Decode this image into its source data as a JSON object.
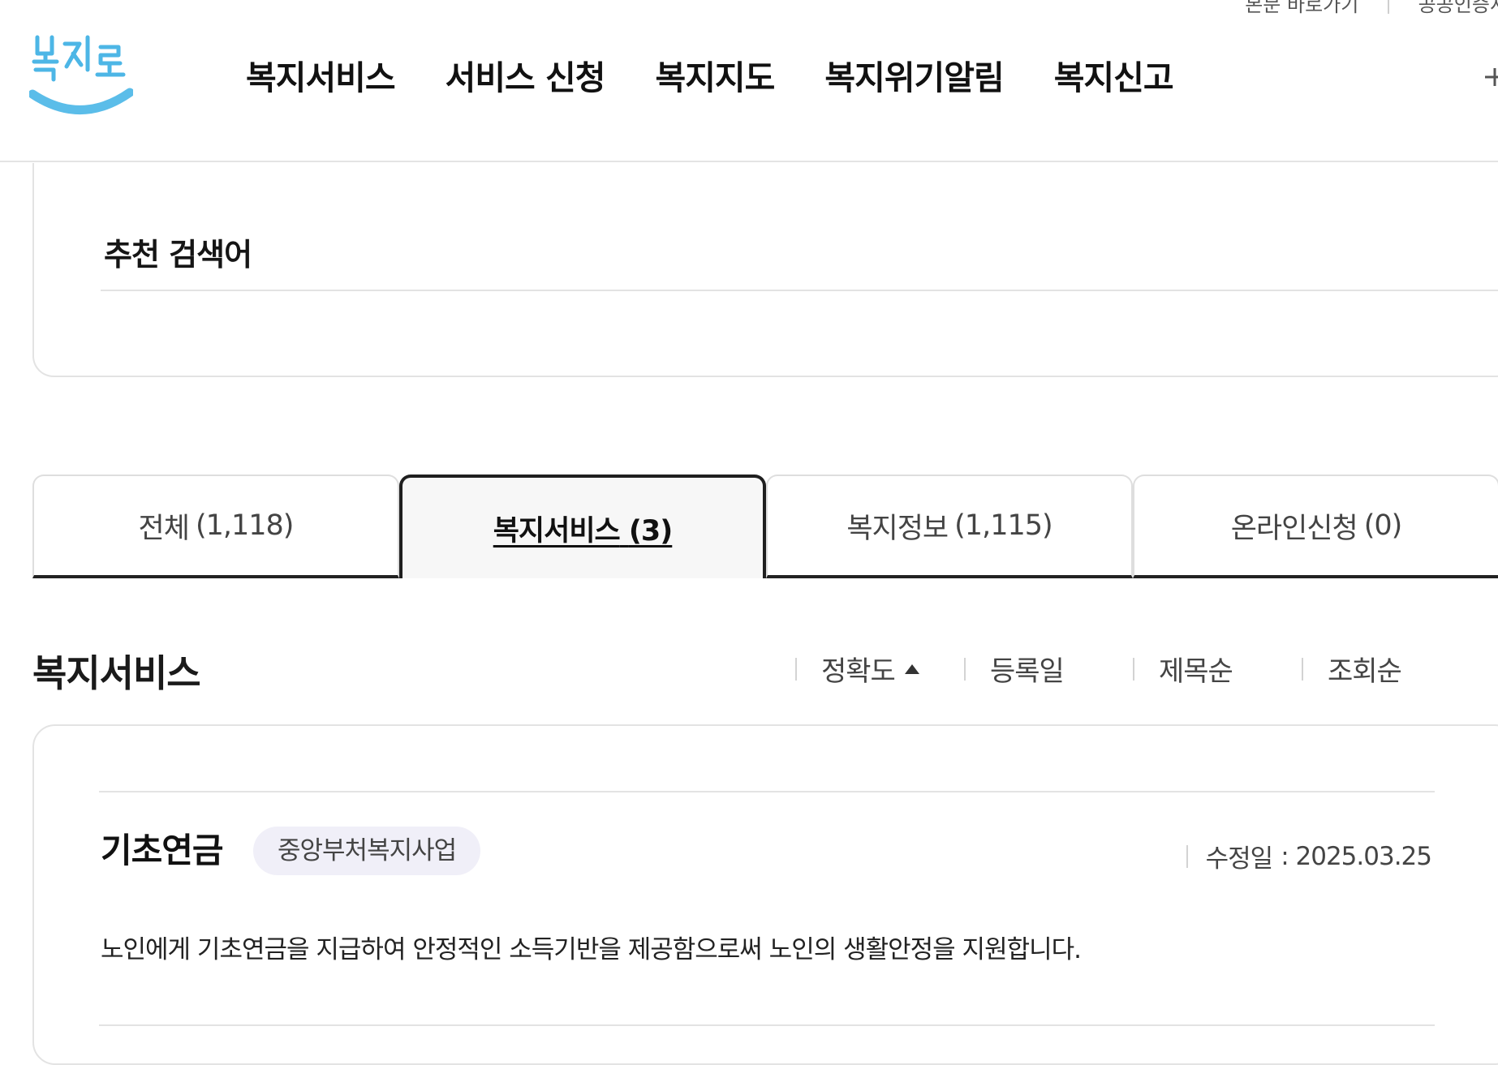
{
  "header": {
    "logo_text": "복지로",
    "utility_links": [
      "본문 바로가기",
      "공공인증서"
    ],
    "nav": [
      "복지서비스",
      "서비스 신청",
      "복지지도",
      "복지위기알림",
      "복지신고"
    ]
  },
  "recommend": {
    "title": "추천 검색어"
  },
  "tabs": [
    {
      "label": "전체",
      "count": "(1,118)",
      "active": false
    },
    {
      "label": "복지서비스",
      "count": "(3)",
      "active": true
    },
    {
      "label": "복지정보",
      "count": "(1,115)",
      "active": false
    },
    {
      "label": "온라인신청",
      "count": "(0)",
      "active": false
    }
  ],
  "section": {
    "title": "복지서비스",
    "sort": [
      "정확도",
      "등록일",
      "제목순",
      "조회순"
    ],
    "active_sort": "정확도"
  },
  "results": [
    {
      "title": "기초연금",
      "badge": "중앙부처복지사업",
      "date_label": "수정일",
      "date_value": ": 2025.03.25",
      "description": "노인에게 기초연금을 지급하여 안정적인 소득기반을 제공함으로써 노인의 생활안정을 지원합니다."
    }
  ],
  "colors": {
    "logo_text": "#4db6e6",
    "badge_bg": "#f0eff8",
    "active_tab_bg": "#f7f7f7",
    "border": "#e3e3e3"
  }
}
